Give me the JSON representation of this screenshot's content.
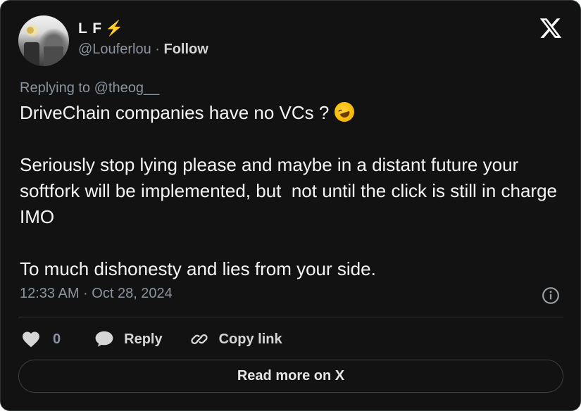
{
  "author": {
    "name": "L F",
    "badge": "⚡",
    "handle": "@Louferlou",
    "separator": "·",
    "follow_label": "Follow"
  },
  "reply_to": "Replying to @theog__",
  "tweet": {
    "line1": "DriveChain companies have no VCs ?",
    "line1_emoji": "rolling-on-the-floor-laughing-emoji",
    "paragraph2": "Seriously stop lying please and maybe in a distant future your softfork will be implemented, but  not until the click is still in charge IMO",
    "paragraph3": "To much dishonesty and lies from your side."
  },
  "timestamp": "12:33 AM · Oct 28, 2024",
  "actions": {
    "like_count": "0",
    "reply_label": "Reply",
    "copy_label": "Copy link"
  },
  "read_more_label": "Read more on X",
  "icons": {
    "platform": "x-logo-icon",
    "info": "info-icon",
    "like": "heart-icon",
    "reply": "speech-bubble-icon",
    "copy": "link-icon"
  },
  "colors": {
    "background": "#121212",
    "text_primary": "#f5f5f5",
    "text_secondary": "#8b949e",
    "border": "#2f3336",
    "badge": "#f2c200"
  }
}
